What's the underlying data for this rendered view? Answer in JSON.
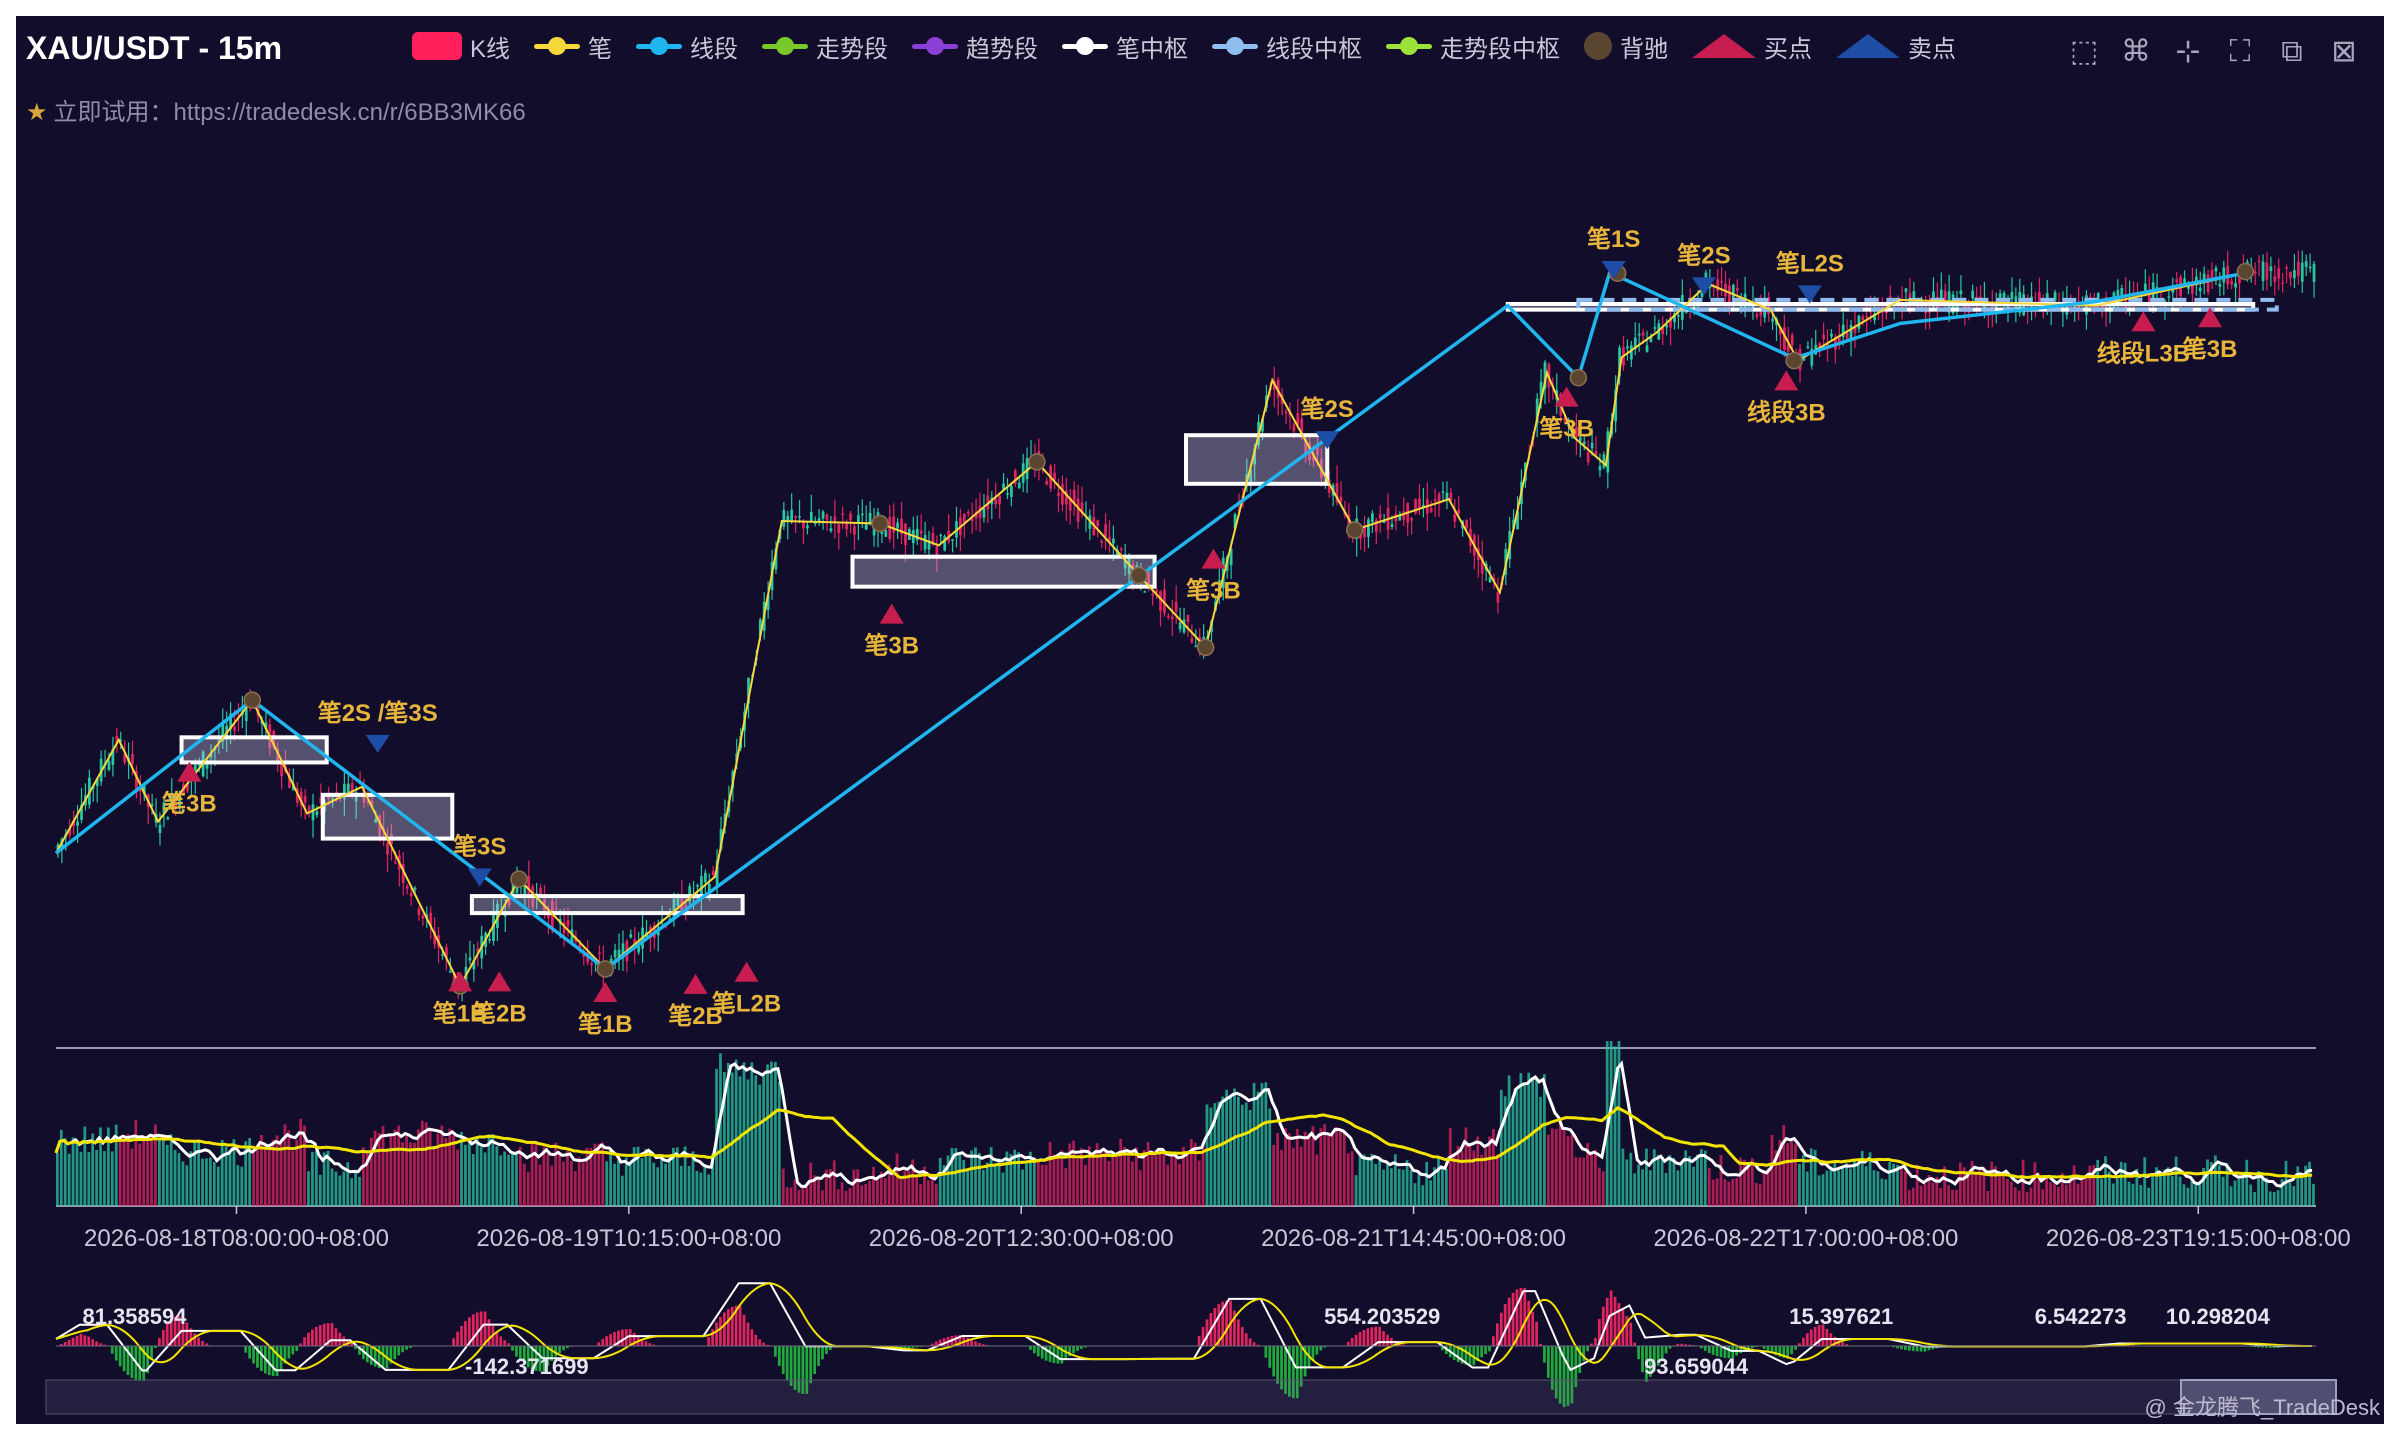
{
  "header": {
    "title": "XAU/USDT - 15m",
    "subtitle": "立即试用：https://tradedesk.cn/r/6BB3MK66",
    "star_icon": "star-icon"
  },
  "legend": [
    {
      "label": "K线",
      "color": "#ff1f5a",
      "kind": "rect"
    },
    {
      "label": "笔",
      "color": "#f7d83c",
      "kind": "line"
    },
    {
      "label": "线段",
      "color": "#1fb6f0",
      "kind": "line"
    },
    {
      "label": "走势段",
      "color": "#7ac92a",
      "kind": "line"
    },
    {
      "label": "趋势段",
      "color": "#8a3fd6",
      "kind": "line"
    },
    {
      "label": "笔中枢",
      "color": "#ffffff",
      "kind": "line"
    },
    {
      "label": "线段中枢",
      "color": "#8fbdf0",
      "kind": "line"
    },
    {
      "label": "走势段中枢",
      "color": "#9be23a",
      "kind": "line"
    },
    {
      "label": "背驰",
      "color": "#5a4630",
      "kind": "dot"
    },
    {
      "label": "买点",
      "color": "#c81e4f",
      "kind": "buy"
    },
    {
      "label": "卖点",
      "color": "#1e4da6",
      "kind": "sell"
    }
  ],
  "toolbox": [
    "zoom-select-icon",
    "lasso-icon",
    "drag-icon",
    "fullscreen-icon",
    "restore-icon",
    "close-icon"
  ],
  "colors": {
    "background": "#130d2c",
    "up": "#27c7a0",
    "down": "#e0245e",
    "bi": "#f7d83c",
    "segment": "#1fb6f0",
    "pivot": "#ffffff",
    "seg_pivot": "#8fbdf0",
    "label": "#e7b53a",
    "buy": "#c81e4f",
    "sell": "#1e4da6",
    "divergence": "#5a4630"
  },
  "chart_data": {
    "type": "candlestick",
    "index_range": [
      0,
      576
    ],
    "price_range": [
      0,
      100
    ],
    "x_axis_labels": [
      {
        "i": 46,
        "text": "2026-08-18T08:00:00+08:00"
      },
      {
        "i": 146,
        "text": "2026-08-19T10:15:00+08:00"
      },
      {
        "i": 246,
        "text": "2026-08-20T12:30:00+08:00"
      },
      {
        "i": 346,
        "text": "2026-08-21T14:45:00+08:00"
      },
      {
        "i": 446,
        "text": "2026-08-22T17:00:00+08:00"
      },
      {
        "i": 546,
        "text": "2026-08-23T19:15:00+08:00"
      }
    ],
    "bi": [
      [
        0,
        16.4
      ],
      [
        16,
        30.4
      ],
      [
        26,
        20.3
      ],
      [
        50,
        35.3
      ],
      [
        64,
        21.3
      ],
      [
        78,
        24.6
      ],
      [
        103,
        0
      ],
      [
        118,
        13.2
      ],
      [
        140,
        2.1
      ],
      [
        168,
        13.5
      ],
      [
        185,
        57.4
      ],
      [
        210,
        57.1
      ],
      [
        225,
        54.4
      ],
      [
        250,
        64.7
      ],
      [
        276,
        50.7
      ],
      [
        293,
        41.8
      ],
      [
        310,
        74.8
      ],
      [
        331,
        56.3
      ],
      [
        355,
        60.1
      ],
      [
        380,
        75.7
      ],
      [
        368,
        48.6
      ],
      [
        387,
        67.7
      ],
      [
        395,
        64.3
      ],
      [
        399,
        77.6
      ],
      [
        408,
        80.7
      ],
      [
        421,
        86.7
      ],
      [
        437,
        83.5
      ],
      [
        444,
        77.2
      ],
      [
        470,
        84.7
      ],
      [
        520,
        84.0
      ],
      [
        560,
        88.2
      ]
    ],
    "segments": [
      [
        0,
        16.4
      ],
      [
        50,
        35.3
      ],
      [
        140,
        2.1
      ],
      [
        370,
        84.0
      ],
      [
        388,
        75.1
      ],
      [
        396,
        88.1
      ],
      [
        443,
        77.5
      ],
      [
        470,
        81.8
      ],
      [
        520,
        84.5
      ],
      [
        560,
        88.2
      ]
    ],
    "bi_pivots": [
      {
        "i0": 32,
        "i1": 69,
        "top": 30.7,
        "bottom": 27.6
      },
      {
        "i0": 68,
        "i1": 101,
        "top": 23.6,
        "bottom": 18.2
      },
      {
        "i0": 106,
        "i1": 175,
        "top": 11.1,
        "bottom": 9.0
      },
      {
        "i0": 203,
        "i1": 280,
        "top": 53.0,
        "bottom": 49.3
      },
      {
        "i0": 288,
        "i1": 324,
        "top": 68.0,
        "bottom": 62.0
      },
      {
        "i0": 370,
        "i1": 560,
        "top": 84.2,
        "bottom": 83.5
      }
    ],
    "segment_pivots": [
      {
        "i0": 388,
        "i1": 566,
        "top": 84.7,
        "bottom": 83.5
      }
    ],
    "divergence": [
      [
        50,
        35.3
      ],
      [
        103,
        0
      ],
      [
        118,
        13.2
      ],
      [
        140,
        2.1
      ],
      [
        210,
        57.1
      ],
      [
        250,
        64.7
      ],
      [
        276,
        50.7
      ],
      [
        293,
        41.8
      ],
      [
        331,
        56.3
      ],
      [
        388,
        75.1
      ],
      [
        398,
        88.0
      ],
      [
        443,
        77.2
      ],
      [
        558,
        88.2
      ]
    ],
    "buy_points": [
      {
        "i": 34,
        "p": 27.7,
        "label": "笔3B"
      },
      {
        "i": 103,
        "p": 1.8,
        "label": "笔1B"
      },
      {
        "i": 113,
        "p": 1.8,
        "label": "笔2B"
      },
      {
        "i": 140,
        "p": 0.5,
        "label": "笔1B"
      },
      {
        "i": 163,
        "p": 1.5,
        "label": "笔2B"
      },
      {
        "i": 176,
        "p": 3.0,
        "label": "笔L2B"
      },
      {
        "i": 213,
        "p": 47.2,
        "label": "笔3B"
      },
      {
        "i": 295,
        "p": 54.0,
        "label": "笔3B"
      },
      {
        "i": 385,
        "p": 74.0,
        "label": "笔3B"
      },
      {
        "i": 441,
        "p": 76.0,
        "label": "线段3B"
      },
      {
        "i": 532,
        "p": 83.3,
        "label": "线段L3B"
      },
      {
        "i": 549,
        "p": 83.8,
        "label": "笔3B"
      }
    ],
    "sell_points": [
      {
        "i": 82,
        "p": 31.0,
        "label": "笔2S /笔3S"
      },
      {
        "i": 108,
        "p": 14.5,
        "label": "笔3S"
      },
      {
        "i": 324,
        "p": 68.5,
        "label": "笔2S"
      },
      {
        "i": 397,
        "p": 89.5,
        "label": "笔1S"
      },
      {
        "i": 420,
        "p": 87.5,
        "label": "笔2S"
      },
      {
        "i": 447,
        "p": 86.5,
        "label": "笔L2S"
      }
    ],
    "volume_indicator": {
      "lines": [
        "white",
        "yellow"
      ],
      "range": [
        0,
        100
      ]
    },
    "macd": {
      "range": [
        -100,
        100
      ],
      "annotations": [
        {
          "text": "81.358594",
          "i": 20
        },
        {
          "text": "-142.371699",
          "i": 120
        },
        {
          "text": "554.203529",
          "i": 338
        },
        {
          "text": "15.397621",
          "i": 455
        },
        {
          "text": "93.659044",
          "i": 418
        },
        {
          "text": "6.542273",
          "i": 516
        },
        {
          "text": "10.298204",
          "i": 551
        }
      ]
    }
  },
  "watermark": "@ 金龙腾飞_TradeDesk"
}
